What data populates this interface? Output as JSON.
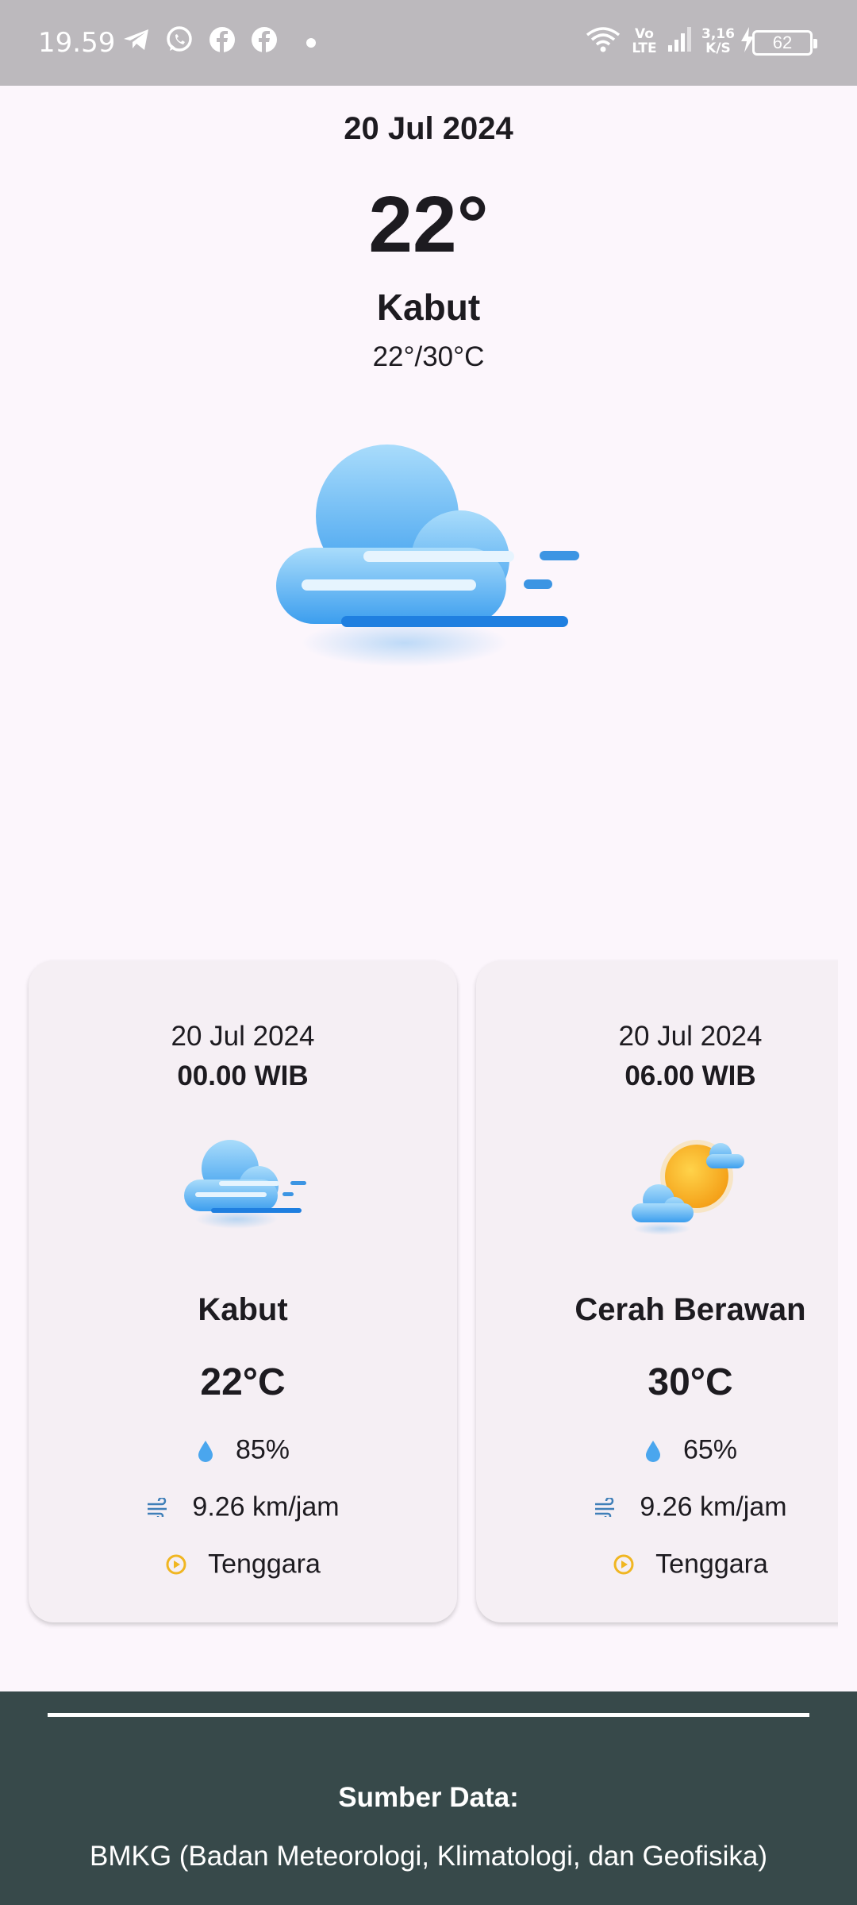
{
  "status_bar": {
    "time": "19.59",
    "icons": [
      "telegram-icon",
      "whatsapp-icon",
      "facebook-icon",
      "facebook-icon",
      "dot-icon",
      "wifi-icon",
      "volte-icon",
      "signal-icon",
      "charging-icon"
    ],
    "volte_text_top": "Vo",
    "volte_text_bottom": "LTE",
    "speed_value": "3,16",
    "speed_unit": "K/S",
    "battery": "62"
  },
  "current": {
    "date": "20 Jul 2024",
    "temperature": "22°",
    "condition": "Kabut",
    "range": "22°/30°C",
    "icon": "fog-cloud-icon"
  },
  "forecasts": [
    {
      "date": "20 Jul 2024",
      "time": "00.00 WIB",
      "icon": "fog-cloud-icon",
      "condition": "Kabut",
      "temperature": "22°C",
      "humidity": "85%",
      "wind_speed": "9.26 km/jam",
      "wind_direction": "Tenggara"
    },
    {
      "date": "20 Jul 2024",
      "time": "06.00 WIB",
      "icon": "sun-cloud-icon",
      "condition": "Cerah Berawan",
      "temperature": "30°C",
      "humidity": "65%",
      "wind_speed": "9.26 km/jam",
      "wind_direction": "Tenggara"
    }
  ],
  "footer": {
    "title": "Sumber Data:",
    "body": "BMKG (Badan Meteorologi, Klimatologi, dan Geofisika)"
  },
  "colors": {
    "background": "#fcf6fc",
    "card": "#f5eff4",
    "footer": "#37494a",
    "status_bar": "#bcb9bd",
    "cloud_blue": "#4aa6ee",
    "sun_orange": "#f7a418"
  }
}
